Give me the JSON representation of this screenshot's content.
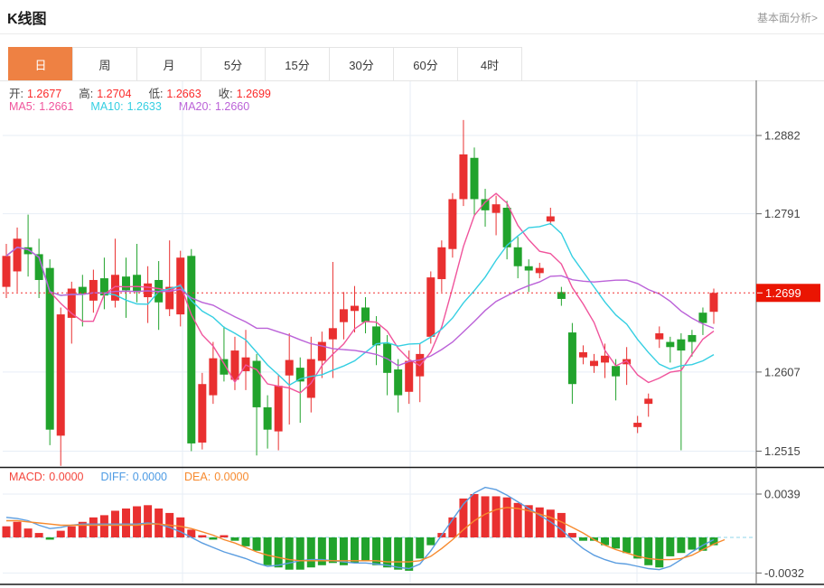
{
  "header": {
    "title": "K线图",
    "link": "基本面分析>"
  },
  "tabs": {
    "items": [
      "日",
      "周",
      "月",
      "5分",
      "15分",
      "30分",
      "60分",
      "4时"
    ],
    "active": 0
  },
  "info": {
    "ohlc": [
      {
        "label": "开:",
        "value": "1.2677"
      },
      {
        "label": "高:",
        "value": "1.2704"
      },
      {
        "label": "低:",
        "value": "1.2663"
      },
      {
        "label": "收:",
        "value": "1.2699"
      }
    ],
    "ohlc_value_color": "#fb2a2a",
    "ma": [
      {
        "label": "MA5:",
        "value": "1.2661",
        "color": "#f0549c"
      },
      {
        "label": "MA10:",
        "value": "1.2633",
        "color": "#35cfe2"
      },
      {
        "label": "MA20:",
        "value": "1.2660",
        "color": "#bb62d8"
      }
    ],
    "macd": [
      {
        "label": "MACD:",
        "value": "0.0000",
        "color": "#f4453c"
      },
      {
        "label": "DIFF:",
        "value": "0.0000",
        "color": "#4d9be4"
      },
      {
        "label": "DEA:",
        "value": "0.0000",
        "color": "#f78a2e"
      }
    ]
  },
  "chart_data": {
    "type": "candlestick+macd",
    "price_axis": {
      "ticks": [
        {
          "label": "1.2882",
          "value": 1.2882
        },
        {
          "label": "1.2791",
          "value": 1.2791
        },
        {
          "label": "1.2607",
          "value": 1.2607
        },
        {
          "label": "1.2515",
          "value": 1.2515
        }
      ],
      "max": 1.2882,
      "min": 1.2515,
      "current_label": "1.2699",
      "current_value": 1.2699
    },
    "macd_axis": {
      "ticks": [
        {
          "label": "0.0039",
          "value": 0.0039
        },
        {
          "label": "-0.0032",
          "value": -0.0032
        }
      ],
      "max": 0.0039,
      "min": -0.0032
    },
    "candles_ohlc_order": [
      "open",
      "high",
      "low",
      "close"
    ],
    "candles": [
      [
        1.2706,
        1.2756,
        1.2693,
        1.2742
      ],
      [
        1.2724,
        1.2775,
        1.27,
        1.2762
      ],
      [
        1.2752,
        1.279,
        1.2718,
        1.2744
      ],
      [
        1.2744,
        1.2762,
        1.2693,
        1.2714
      ],
      [
        1.2728,
        1.2738,
        1.2522,
        1.254
      ],
      [
        1.2533,
        1.2682,
        1.2498,
        1.2674
      ],
      [
        1.267,
        1.2712,
        1.264,
        1.2704
      ],
      [
        1.2706,
        1.272,
        1.266,
        1.2698
      ],
      [
        1.269,
        1.2726,
        1.2676,
        1.2714
      ],
      [
        1.2716,
        1.274,
        1.268,
        1.2696
      ],
      [
        1.269,
        1.2762,
        1.2682,
        1.272
      ],
      [
        1.2718,
        1.274,
        1.267,
        1.2702
      ],
      [
        1.272,
        1.2756,
        1.2688,
        1.27
      ],
      [
        1.2694,
        1.273,
        1.2664,
        1.271
      ],
      [
        1.2714,
        1.2736,
        1.2656,
        1.2688
      ],
      [
        1.268,
        1.276,
        1.2672,
        1.2706
      ],
      [
        1.2674,
        1.2748,
        1.266,
        1.274
      ],
      [
        1.2742,
        1.275,
        1.2515,
        1.2524
      ],
      [
        1.2525,
        1.2606,
        1.2517,
        1.2593
      ],
      [
        1.258,
        1.2642,
        1.257,
        1.2623
      ],
      [
        1.2622,
        1.266,
        1.2596,
        1.2604
      ],
      [
        1.2598,
        1.2648,
        1.2586,
        1.2632
      ],
      [
        1.2608,
        1.2656,
        1.2586,
        1.2624
      ],
      [
        1.262,
        1.2628,
        1.251,
        1.2566
      ],
      [
        1.2566,
        1.258,
        1.2518,
        1.254
      ],
      [
        1.2538,
        1.2604,
        1.2516,
        1.2591
      ],
      [
        1.2603,
        1.2652,
        1.2546,
        1.2621
      ],
      [
        1.2612,
        1.2624,
        1.2548,
        1.2596
      ],
      [
        1.2577,
        1.2648,
        1.256,
        1.2622
      ],
      [
        1.262,
        1.2654,
        1.26,
        1.2642
      ],
      [
        1.2645,
        1.2735,
        1.26,
        1.2658
      ],
      [
        1.2665,
        1.27,
        1.2645,
        1.268
      ],
      [
        1.2678,
        1.2707,
        1.2653,
        1.2684
      ],
      [
        1.2682,
        1.2694,
        1.2652,
        1.2665
      ],
      [
        1.266,
        1.2672,
        1.2615,
        1.2638
      ],
      [
        1.264,
        1.265,
        1.258,
        1.2606
      ],
      [
        1.261,
        1.2622,
        1.256,
        1.258
      ],
      [
        1.2584,
        1.2632,
        1.257,
        1.262
      ],
      [
        1.2602,
        1.264,
        1.2572,
        1.2628
      ],
      [
        1.2648,
        1.2724,
        1.264,
        1.2717
      ],
      [
        1.2715,
        1.276,
        1.27,
        1.2752
      ],
      [
        1.275,
        1.2815,
        1.274,
        1.2808
      ],
      [
        1.2808,
        1.29,
        1.28,
        1.286
      ],
      [
        1.2856,
        1.2868,
        1.279,
        1.2808
      ],
      [
        1.2808,
        1.282,
        1.2776,
        1.2795
      ],
      [
        1.2792,
        1.2812,
        1.2766,
        1.2802
      ],
      [
        1.2798,
        1.2806,
        1.2738,
        1.2752
      ],
      [
        1.2752,
        1.2764,
        1.2716,
        1.273
      ],
      [
        1.273,
        1.2738,
        1.27,
        1.2725
      ],
      [
        1.2722,
        1.2734,
        1.2716,
        1.2728
      ],
      [
        1.2782,
        1.2798,
        1.2778,
        1.2788
      ],
      [
        1.27,
        1.2706,
        1.2684,
        1.2692
      ],
      [
        1.2653,
        1.2664,
        1.257,
        1.2593
      ],
      [
        1.2624,
        1.2638,
        1.2616,
        1.263
      ],
      [
        1.2614,
        1.2628,
        1.2606,
        1.262
      ],
      [
        1.2618,
        1.264,
        1.26,
        1.2626
      ],
      [
        1.2614,
        1.2622,
        1.2574,
        1.2602
      ],
      [
        1.2616,
        1.2636,
        1.2592,
        1.2622
      ],
      [
        1.2543,
        1.2556,
        1.2536,
        1.2548
      ],
      [
        1.257,
        1.2582,
        1.2555,
        1.2576
      ],
      [
        1.2645,
        1.266,
        1.2635,
        1.2652
      ],
      [
        1.2642,
        1.2648,
        1.2618,
        1.2636
      ],
      [
        1.2645,
        1.2652,
        1.2516,
        1.2632
      ],
      [
        1.265,
        1.2656,
        1.2625,
        1.2642
      ],
      [
        1.2676,
        1.2682,
        1.265,
        1.2664
      ],
      [
        1.2677,
        1.2704,
        1.2663,
        1.2699
      ]
    ],
    "ma_periods": [
      5,
      10,
      20
    ],
    "macd_hist_x1e4": [
      10,
      14,
      8,
      4,
      -2,
      6,
      10,
      14,
      18,
      20,
      24,
      26,
      28,
      29,
      26,
      22,
      18,
      7,
      2,
      -2,
      2,
      -3,
      -8,
      -12,
      -25,
      -27,
      -29,
      -29,
      -27,
      -25,
      -23,
      -25,
      -23,
      -21,
      -25,
      -27,
      -29,
      -30,
      -19,
      -7,
      4,
      18,
      35,
      39,
      37,
      37,
      36,
      31,
      29,
      27,
      25,
      22,
      4,
      -3,
      -3,
      -7,
      -10,
      -14,
      -19,
      -25,
      -27,
      -17,
      -14,
      -11,
      -12,
      -7
    ],
    "diff_x1e4": [
      18,
      17,
      15,
      11,
      8,
      9,
      11,
      12,
      12,
      12,
      12,
      12,
      12,
      13,
      12,
      9,
      5,
      0,
      -5,
      -9,
      -13,
      -16,
      -19,
      -23,
      -26,
      -25,
      -23,
      -21,
      -20,
      -20,
      -21,
      -22,
      -23,
      -23,
      -24,
      -25,
      -27,
      -28,
      -24,
      -12,
      2,
      16,
      30,
      40,
      45,
      43,
      38,
      32,
      26,
      20,
      14,
      7,
      -2,
      -10,
      -16,
      -20,
      -23,
      -24,
      -26,
      -28,
      -29,
      -26,
      -20,
      -13,
      -7,
      -2
    ],
    "dea_x1e4": [
      15,
      15,
      14,
      13,
      12,
      11,
      11,
      11,
      11,
      11,
      11,
      11,
      11,
      12,
      12,
      11,
      10,
      8,
      5,
      2,
      -2,
      -5,
      -9,
      -13,
      -16,
      -18,
      -20,
      -21,
      -21,
      -21,
      -21,
      -21,
      -21,
      -21,
      -21,
      -22,
      -22,
      -22,
      -21,
      -17,
      -10,
      -2,
      7,
      15,
      21,
      25,
      27,
      26,
      24,
      21,
      18,
      14,
      9,
      4,
      -2,
      -7,
      -11,
      -14,
      -17,
      -19,
      -20,
      -20,
      -19,
      -16,
      -11,
      -6,
      -2
    ],
    "colors": {
      "up": "#e93030",
      "down": "#21a32c",
      "ma5": "#f0549c",
      "ma10": "#35cfe2",
      "ma20": "#bb62d8",
      "diff": "#5b9de0",
      "dea": "#f78a2e",
      "grid": "#e7eef6",
      "axis": "#666666",
      "current_line": "#f23030",
      "current_tag_bg": "#ea1502",
      "current_tag_text": "#ffffff",
      "zero_dash": "#8fd4ea",
      "tick_text": "#444444"
    },
    "legend_position": "top-left",
    "grid": true
  }
}
